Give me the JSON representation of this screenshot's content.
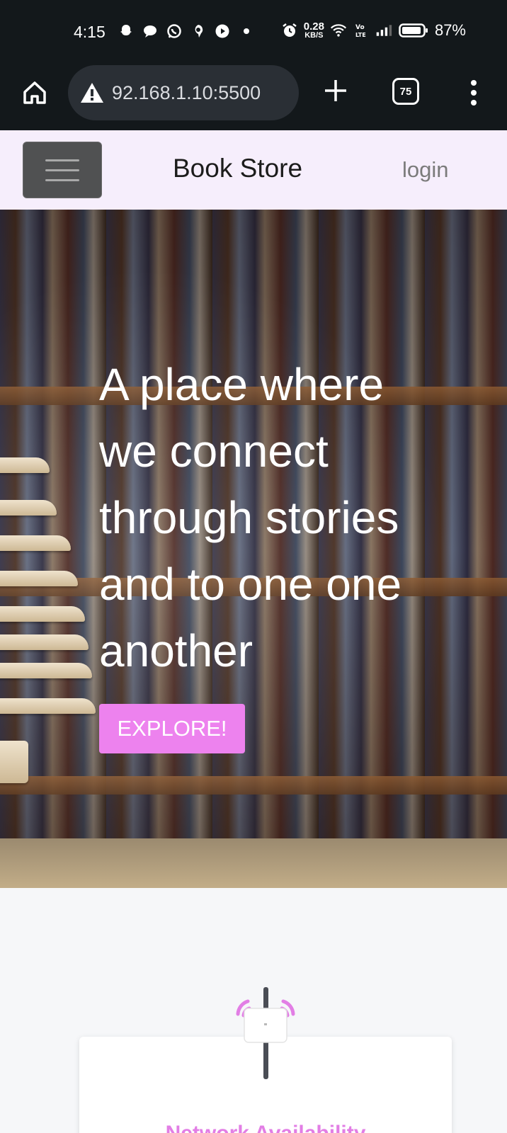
{
  "status_bar": {
    "time": "4:15",
    "net_speed_value": "0.28",
    "net_speed_unit": "KB/S",
    "battery_percent": "87%",
    "icons": [
      "snapchat-icon",
      "chat-bubble-icon",
      "whatsapp-icon",
      "signal-icon",
      "youtube-icon",
      "dot-icon",
      "alarm-icon",
      "wifi-icon",
      "volte-icon",
      "cell-signal-icon",
      "battery-icon"
    ]
  },
  "browser": {
    "url": "92.168.1.10:5500",
    "tab_count": "75",
    "icons": [
      "home-icon",
      "warning-icon",
      "plus-icon",
      "tabs-icon",
      "more-vert-icon"
    ]
  },
  "navbar": {
    "brand": "Book Store",
    "login_label": "login"
  },
  "hero": {
    "headline": "A place where we connect through stories and to one one another",
    "cta_label": "EXPLORE!",
    "cta_color": "#ed82ee"
  },
  "features": {
    "card_title": "Network Availability",
    "accent_color": "#e27ee5"
  }
}
